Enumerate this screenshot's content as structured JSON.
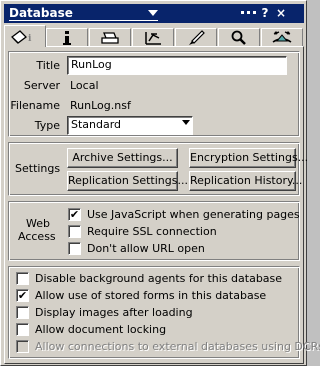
{
  "window": {
    "title": "Database",
    "help": "?",
    "close": "×"
  },
  "tabs": [
    {
      "icon": "info-icon"
    },
    {
      "icon": "i-icon"
    },
    {
      "icon": "printer-icon"
    },
    {
      "icon": "design-icon"
    },
    {
      "icon": "rocket-icon"
    },
    {
      "icon": "search-icon"
    },
    {
      "icon": "hat-icon"
    }
  ],
  "info": {
    "title_label": "Title",
    "title_value": "RunLog",
    "server_label": "Server",
    "server_value": "Local",
    "filename_label": "Filename",
    "filename_value": "RunLog.nsf",
    "type_label": "Type",
    "type_value": "Standard"
  },
  "settings": {
    "label": "Settings",
    "archive": "Archive Settings...",
    "encryption": "Encryption Settings...",
    "replication": "Replication Settings...",
    "history": "Replication History..."
  },
  "web": {
    "label_line1": "Web",
    "label_line2": "Access",
    "options": [
      {
        "label": "Use JavaScript when generating pages",
        "checked": true,
        "mark": "✔"
      },
      {
        "label": "Require SSL connection",
        "checked": false,
        "mark": ""
      },
      {
        "label": "Don't allow URL open",
        "checked": false,
        "mark": ""
      }
    ]
  },
  "options": [
    {
      "label": "Disable background agents for this database",
      "checked": false,
      "mark": ""
    },
    {
      "label": "Allow use of stored forms in this database",
      "checked": true,
      "mark": "✔"
    },
    {
      "label": "Display images after loading",
      "checked": false,
      "mark": ""
    },
    {
      "label": "Allow document locking",
      "checked": false,
      "mark": ""
    },
    {
      "label": "Allow connections to external databases using DCRs",
      "checked": false,
      "mark": "",
      "disabled": true
    }
  ],
  "colors": {
    "titlebar": "#08246b",
    "face": "#d4d0c8",
    "disabled": "#808080"
  }
}
